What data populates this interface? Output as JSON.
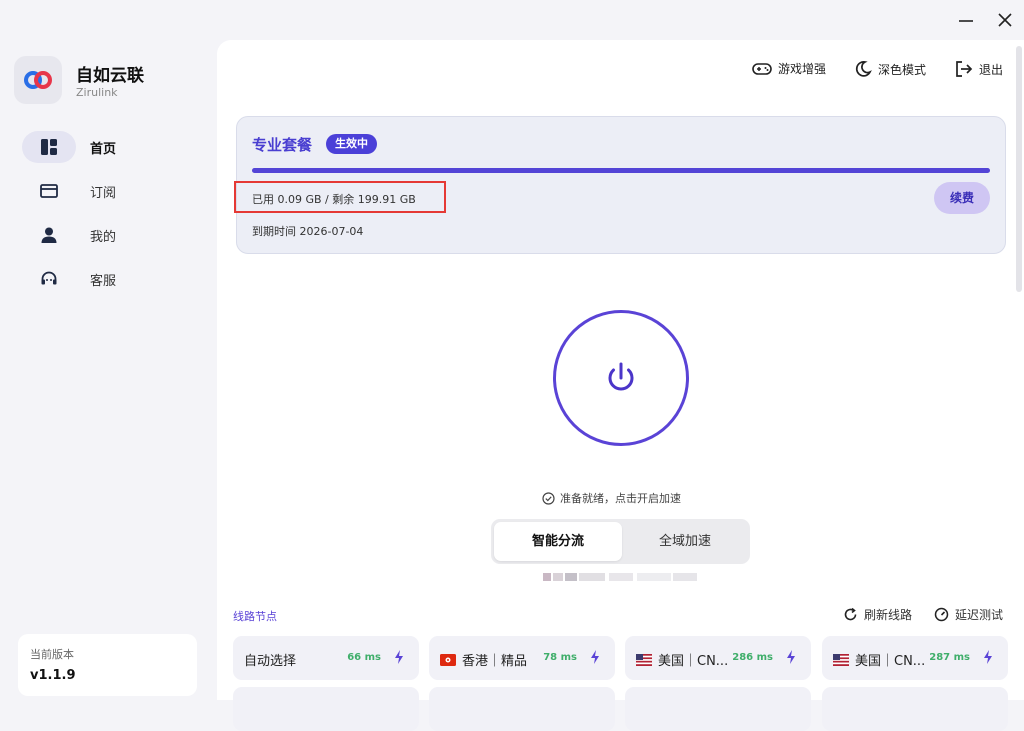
{
  "window": {
    "minimize_glyph": "—",
    "close_glyph": "✕"
  },
  "brand": {
    "name": "自如云联",
    "subtitle": "Zirulink",
    "logo_icon": "infinity-logo"
  },
  "sidebar": {
    "items": [
      {
        "label": "首页",
        "icon": "dashboard-icon",
        "active": true
      },
      {
        "label": "订阅",
        "icon": "card-icon",
        "active": false
      },
      {
        "label": "我的",
        "icon": "person-icon",
        "active": false
      },
      {
        "label": "客服",
        "icon": "headset-icon",
        "active": false
      }
    ],
    "version_label": "当前版本",
    "version_value": "v1.1.9"
  },
  "header": {
    "game_boost": "游戏增强",
    "dark_mode": "深色模式",
    "logout": "退出"
  },
  "plan": {
    "title": "专业套餐",
    "badge": "生效中",
    "usage": "已用 0.09 GB / 剩余 199.91 GB",
    "expiry": "到期时间 2026-07-04",
    "renew_label": "续费",
    "used_fraction": 0.99955
  },
  "connection": {
    "status_text": "准备就绪，点击开启加速",
    "modes": [
      "智能分流",
      "全域加速"
    ],
    "active_mode": "智能分流"
  },
  "nodes": {
    "title": "线路节点",
    "refresh_label": "刷新线路",
    "latency_test_label": "延迟测试",
    "items": [
      {
        "name": "自动选择",
        "flag": "",
        "latency": "66 ms"
      },
      {
        "name": "香港｜精品",
        "flag": "hk-flag-icon",
        "latency": "78 ms"
      },
      {
        "name": "美国｜CN...",
        "flag": "us-flag-icon",
        "latency": "286 ms"
      },
      {
        "name": "美国｜CN...",
        "flag": "us-flag-icon",
        "latency": "287 ms"
      }
    ]
  },
  "colors": {
    "accent": "#5a43d6",
    "badge": "#4b40d8",
    "latency_green": "#3fae6a",
    "highlight_red": "#e53935"
  }
}
